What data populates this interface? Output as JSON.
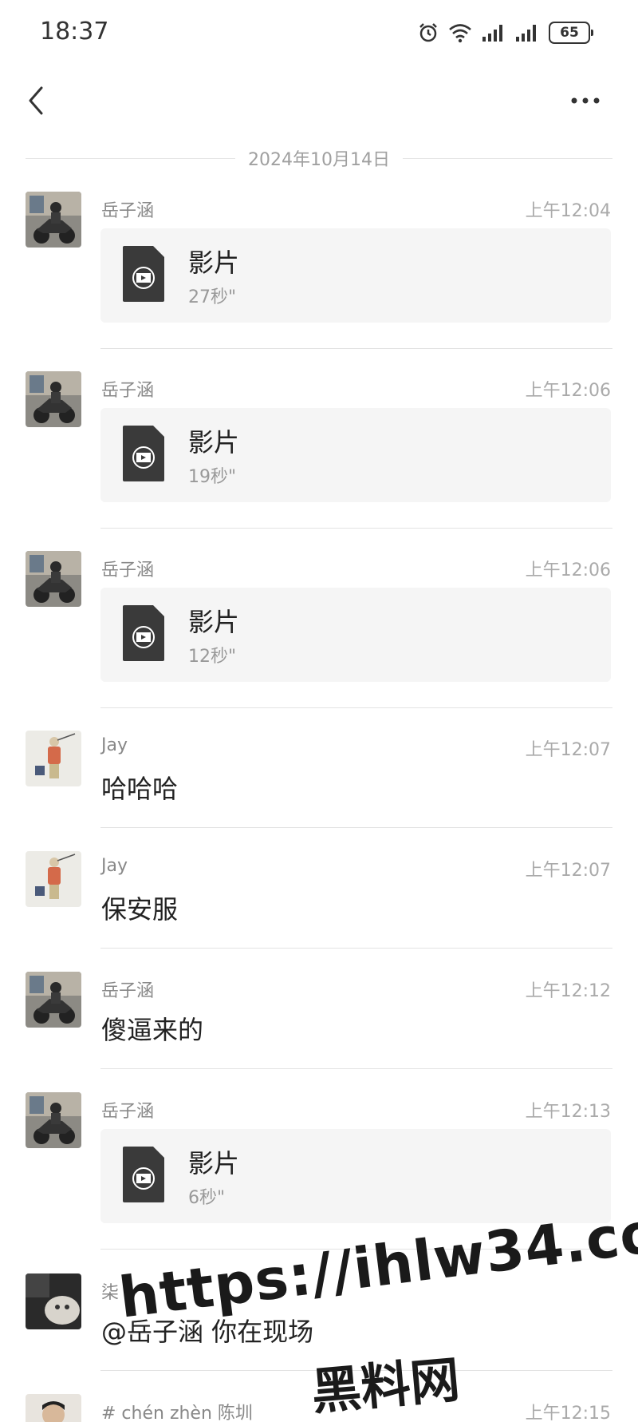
{
  "status_bar": {
    "time": "18:37",
    "battery": "65",
    "icons": [
      "alarm-icon",
      "wifi-icon",
      "signal-icon",
      "signal-icon",
      "battery-icon"
    ]
  },
  "header": {
    "back_icon": "chevron-left-icon",
    "more_icon": "more-horizontal-icon"
  },
  "date_divider": "2024年10月14日",
  "messages": [
    {
      "sender": "岳子涵",
      "time": "上午12:04",
      "type": "video",
      "title": "影片",
      "duration": "27秒\""
    },
    {
      "sender": "岳子涵",
      "time": "上午12:06",
      "type": "video",
      "title": "影片",
      "duration": "19秒\""
    },
    {
      "sender": "岳子涵",
      "time": "上午12:06",
      "type": "video",
      "title": "影片",
      "duration": "12秒\""
    },
    {
      "sender": "Jay",
      "time": "上午12:07",
      "type": "text",
      "text": "哈哈哈"
    },
    {
      "sender": "Jay",
      "time": "上午12:07",
      "type": "text",
      "text": "保安服"
    },
    {
      "sender": "岳子涵",
      "time": "上午12:12",
      "type": "text",
      "text": "傻逼来的"
    },
    {
      "sender": "岳子涵",
      "time": "上午12:13",
      "type": "video",
      "title": "影片",
      "duration": "6秒\""
    },
    {
      "sender": "柒 ~",
      "time": "",
      "type": "text",
      "text": "@岳子涵 你在现场"
    },
    {
      "sender": "# chén zhèn 陈圳",
      "time": "上午12:15",
      "type": "text",
      "text": ""
    }
  ],
  "watermark": {
    "url": "https://ihlw34.com",
    "name": "黑料网"
  }
}
